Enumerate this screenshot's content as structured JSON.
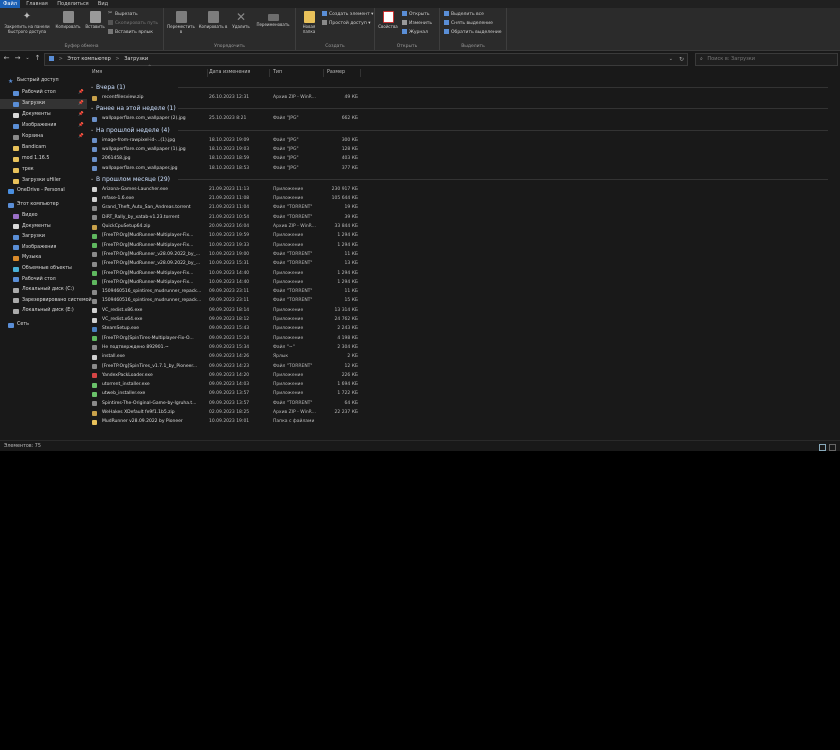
{
  "ribbon_tabs": {
    "file": "Файл",
    "home": "Главная",
    "share": "Поделиться",
    "view": "Вид"
  },
  "clipboard": {
    "pin_label": "Закрепить на панели быстрого доступа",
    "copy_label": "Копировать",
    "paste_label": "Вставить",
    "cut_label": "Вырезать",
    "copy_path_label": "Скопировать путь",
    "paste_shortcut_label": "Вставить ярлык",
    "group_label": "Буфер обмена"
  },
  "organize": {
    "move_label": "Переместить в",
    "copy_to_label": "Копировать в",
    "delete_label": "Удалить",
    "rename_label": "Переименовать",
    "group_label": "Упорядочить"
  },
  "create": {
    "new_folder_label": "Новая папка",
    "new_item_label": "Создать элемент",
    "easy_access_label": "Простой доступ",
    "group_label": "Создать"
  },
  "open": {
    "properties_label": "Свойства",
    "open_label": "Открыть",
    "edit_label": "Изменить",
    "history_label": "Журнал",
    "group_label": "Открыть"
  },
  "select": {
    "select_all_label": "Выделить все",
    "select_none_label": "Снять выделение",
    "invert_label": "Обратить выделение",
    "group_label": "Выделить"
  },
  "address": {
    "root": "Этот компьютер",
    "sep": ">",
    "current": "Загрузки",
    "search_placeholder": "Поиск в: Загрузки",
    "back_glyph": "←",
    "forward_glyph": "→",
    "recent_glyph": "⌄",
    "up_glyph": "↑",
    "refresh_glyph": "↻",
    "search_glyph": "⌕"
  },
  "nav": {
    "quick_access": "Быстрый доступ",
    "items": [
      {
        "label": "Рабочий стол",
        "pinned": "📌"
      },
      {
        "label": "Загрузки",
        "pinned": "📌"
      },
      {
        "label": "Документы",
        "pinned": "📌"
      },
      {
        "label": "Изображения",
        "pinned": "📌"
      },
      {
        "label": "Корзина",
        "pinned": "📌"
      },
      {
        "label": "Bandicam",
        "pinned": ""
      },
      {
        "label": "mod 1.16.5",
        "pinned": ""
      },
      {
        "label": "трек",
        "pinned": ""
      },
      {
        "label": "Загрузки uHiler",
        "pinned": ""
      }
    ],
    "onedrive": "OneDrive - Personal",
    "this_pc": "Этот компьютер",
    "pc_items": [
      "Видео",
      "Документы",
      "Загрузки",
      "Изображения",
      "Музыка",
      "Объемные объекты",
      "Рабочий стол",
      "Локальный диск (C:)",
      "Зарезервировано системой",
      "Локальный диск (E:)"
    ],
    "network": "Сеть"
  },
  "columns": {
    "name": "Имя",
    "date": "Дата изменения",
    "type": "Тип",
    "size": "Размер",
    "sort_glyph": "^"
  },
  "groups": {
    "yesterday": "Вчера (1)",
    "earlier_week": "Ранее на этой неделе (1)",
    "last_week": "На прошлой неделе (4)",
    "last_month": "В прошлом месяце (29)"
  },
  "files": {
    "yesterday": [
      {
        "name": "recentfilesview.zip",
        "date": "26.10.2023 12:31",
        "type": "Архив ZIP - WinR...",
        "size": "49 КБ",
        "color": "#c8a14a"
      }
    ],
    "earlier_week": [
      {
        "name": "wallpaperflare.com_wallpaper (2).jpg",
        "date": "25.10.2023 8:21",
        "type": "Файл \"JPG\"",
        "size": "662 КБ",
        "color": "#6a8fc7"
      }
    ],
    "last_week": [
      {
        "name": "image-from-rawpixel-id-...(1).jpg",
        "date": "18.10.2023 19:09",
        "type": "Файл \"JPG\"",
        "size": "300 КБ",
        "color": "#6a8fc7"
      },
      {
        "name": "wallpaperflare.com_wallpaper (1).jpg",
        "date": "18.10.2023 19:03",
        "type": "Файл \"JPG\"",
        "size": "128 КБ",
        "color": "#6a8fc7"
      },
      {
        "name": "2061458.jpg",
        "date": "18.10.2023 18:59",
        "type": "Файл \"JPG\"",
        "size": "403 КБ",
        "color": "#6a8fc7"
      },
      {
        "name": "wallpaperflare.com_wallpaper.jpg",
        "date": "18.10.2023 18:53",
        "type": "Файл \"JPG\"",
        "size": "377 КБ",
        "color": "#6a8fc7"
      }
    ],
    "last_month": [
      {
        "name": "Arizona-Games-Launcher.exe",
        "date": "21.09.2023 11:13",
        "type": "Приложение",
        "size": "230 917 КБ",
        "color": "#d0d0d0"
      },
      {
        "name": "mfase-1.6.exe",
        "date": "21.09.2023 11:08",
        "type": "Приложение",
        "size": "105 644 КБ",
        "color": "#d0d0d0"
      },
      {
        "name": "Grand_Theft_Auto_San_Andreas.torrent",
        "date": "21.09.2023 11:04",
        "type": "Файл \"TORRENT\"",
        "size": "19 КБ",
        "color": "#8a8a8a"
      },
      {
        "name": "DiRT_Rally_by_xatab-v1.23.torrent",
        "date": "21.09.2023 10:54",
        "type": "Файл \"TORRENT\"",
        "size": "39 КБ",
        "color": "#8a8a8a"
      },
      {
        "name": "QuickCpuSetup64.zip",
        "date": "20.09.2023 16:04",
        "type": "Архив ZIP - WinR...",
        "size": "33 844 КБ",
        "color": "#c8a14a"
      },
      {
        "name": "[FreeTP.Org]MudRunner-Multiplayer-Fix...",
        "date": "10.09.2023 19:59",
        "type": "Приложение",
        "size": "1 294 КБ",
        "color": "#5fb85f"
      },
      {
        "name": "[FreeTP.Org]MudRunner-Multiplayer-Fix...",
        "date": "10.09.2023 19:33",
        "type": "Приложение",
        "size": "1 294 КБ",
        "color": "#5fb85f"
      },
      {
        "name": "[FreeTP.Org]MudRunner_v28.09.2022_by_...",
        "date": "10.09.2023 19:00",
        "type": "Файл \"TORRENT\"",
        "size": "11 КБ",
        "color": "#8a8a8a"
      },
      {
        "name": "[FreeTP.Org]MudRunner_v28.09.2022_by_...",
        "date": "10.09.2023 15:31",
        "type": "Файл \"TORRENT\"",
        "size": "13 КБ",
        "color": "#8a8a8a"
      },
      {
        "name": "[FreeTP.Org]MudRunner-Multiplayer-Fix...",
        "date": "10.09.2023 14:40",
        "type": "Приложение",
        "size": "1 294 КБ",
        "color": "#5fb85f"
      },
      {
        "name": "[FreeTP.Org]MudRunner-Multiplayer-Fix...",
        "date": "10.09.2023 14:40",
        "type": "Приложение",
        "size": "1 294 КБ",
        "color": "#5fb85f"
      },
      {
        "name": "1509460516_spintires_mudrunner_repack...",
        "date": "09.09.2023 23:11",
        "type": "Файл \"TORRENT\"",
        "size": "11 КБ",
        "color": "#8a8a8a"
      },
      {
        "name": "1509460516_spintires_mudrunner_repack...",
        "date": "09.09.2023 23:11",
        "type": "Файл \"TORRENT\"",
        "size": "15 КБ",
        "color": "#8a8a8a"
      },
      {
        "name": "VC_redist.x86.exe",
        "date": "09.09.2023 18:14",
        "type": "Приложение",
        "size": "13 314 КБ",
        "color": "#d0d0d0"
      },
      {
        "name": "VC_redist.x64.exe",
        "date": "09.09.2023 18:12",
        "type": "Приложение",
        "size": "24 762 КБ",
        "color": "#d0d0d0"
      },
      {
        "name": "SteamSetup.exe",
        "date": "09.09.2023 15:43",
        "type": "Приложение",
        "size": "2 243 КБ",
        "color": "#4a7fbf"
      },
      {
        "name": "[FreeTP.Org]SpinTires-Multiplayer-Fix-O...",
        "date": "09.09.2023 15:24",
        "type": "Приложение",
        "size": "4 198 КБ",
        "color": "#5fb85f"
      },
      {
        "name": "Не подтверждено 892901.~",
        "date": "09.09.2023 15:34",
        "type": "Файл \"~\"",
        "size": "2 304 КБ",
        "color": "#8a8a8a"
      },
      {
        "name": "install.exe",
        "date": "09.09.2023 14:26",
        "type": "Ярлык",
        "size": "2 КБ",
        "color": "#d0d0d0"
      },
      {
        "name": "[FreeTP.Org]SpinTires_v1.7.1_by_Pioneer...",
        "date": "09.09.2023 14:23",
        "type": "Файл \"TORRENT\"",
        "size": "12 КБ",
        "color": "#8a8a8a"
      },
      {
        "name": "YandexPackLoader.exe",
        "date": "09.09.2023 14:20",
        "type": "Приложение",
        "size": "226 КБ",
        "color": "#d64545"
      },
      {
        "name": "utorrent_installer.exe",
        "date": "09.09.2023 14:03",
        "type": "Приложение",
        "size": "1 694 КБ",
        "color": "#6ac26a"
      },
      {
        "name": "utweb_installer.exe",
        "date": "09.09.2023 13:57",
        "type": "Приложение",
        "size": "1 722 КБ",
        "color": "#6ac26a"
      },
      {
        "name": "Spintires-The-Original-Game-by-Igruha.t...",
        "date": "09.09.2023 13:57",
        "type": "Файл \"TORRENT\"",
        "size": "64 КБ",
        "color": "#8a8a8a"
      },
      {
        "name": "WeHakes XDefault fe9f1.1b5.zip",
        "date": "02.09.2023 18:25",
        "type": "Архив ZIP - WinR...",
        "size": "22 237 КБ",
        "color": "#c8a14a"
      },
      {
        "name": "MudRunner v28.09.2022 by Pioneer",
        "date": "10.09.2023 19:01",
        "type": "Папка с файлами",
        "size": "",
        "color": "#e8c15a"
      }
    ]
  },
  "status": {
    "count": "Элементов: 75"
  }
}
